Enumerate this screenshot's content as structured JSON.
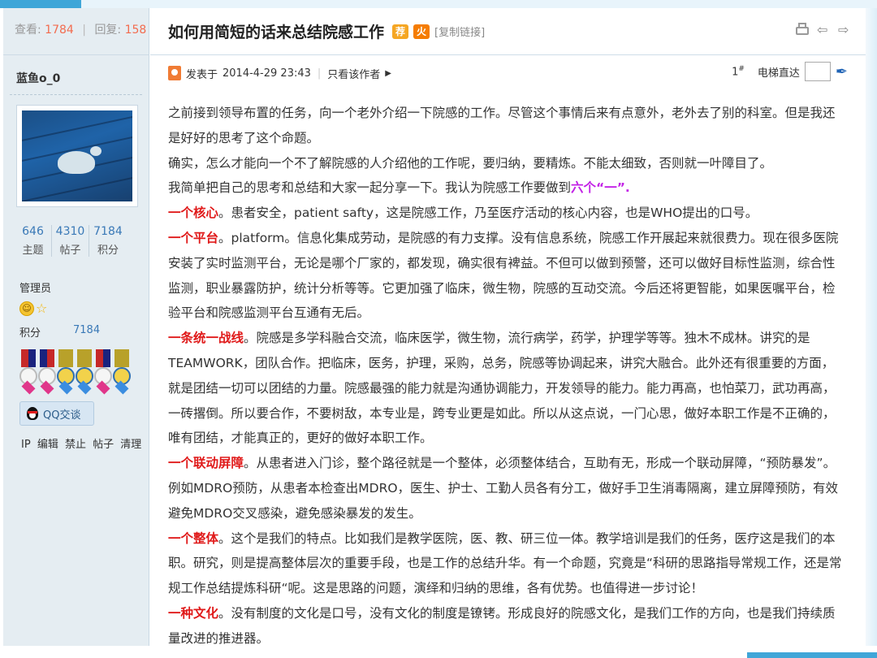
{
  "stats_header": {
    "views_label": "查看:",
    "views": "1784",
    "replies_label": "回复:",
    "replies": "158"
  },
  "thread": {
    "title": "如何用简短的话来总结院感工作",
    "badge1": "荐",
    "badge2": "火",
    "copy_link": "[复制链接]"
  },
  "author": {
    "name": "蓝鱼o_0",
    "stats": [
      {
        "value": "646",
        "label": "主题"
      },
      {
        "value": "4310",
        "label": "帖子"
      },
      {
        "value": "7184",
        "label": "积分"
      }
    ],
    "group": "管理员",
    "points_label": "积分",
    "points_value": "7184",
    "qq_label": "QQ交谈",
    "admin_links": [
      "IP",
      "编辑",
      "禁止",
      "帖子",
      "清理"
    ]
  },
  "post": {
    "posted_label": "发表于",
    "posted_time": "2014-4-29 23:43",
    "only_author": "只看该作者",
    "floor": "1",
    "floor_sup": "#",
    "elevator": "电梯直达"
  },
  "content": {
    "p1": "之前接到领导布置的任务，向一个老外介绍一下院感的工作。尽管这个事情后来有点意外，老外去了别的科室。但是我还是好好的思考了这个命题。",
    "p2": "确实，怎么才能向一个不了解院感的人介绍他的工作呢，要归纳，要精炼。不能太细致，否则就一叶障目了。",
    "p3_a": "我简单把自己的思考和总结和大家一起分享一下。我认为院感工作要做到",
    "p3_b": "六个“一”.",
    "p4_h": "一个核心",
    "p4": "。患者安全，patient safty，这是院感工作，乃至医疗活动的核心内容，也是WHO提出的口号。",
    "p5_h": "一个平台",
    "p5": "。platform。信息化集成劳动，是院感的有力支撑。没有信息系统，院感工作开展起来就很费力。现在很多医院安装了实时监测平台，无论是哪个厂家的，都发现，确实很有裨益。不但可以做到预警，还可以做好目标性监测，综合性监测，职业暴露防护，统计分析等等。它更加强了临床，微生物，院感的互动交流。今后还将更智能，如果医嘱平台，检验平台和院感监测平台互通有无后。",
    "p6_h": "一条统一战线",
    "p6": "。院感是多学科融合交流，临床医学，微生物，流行病学，药学，护理学等等。独木不成林。讲究的是TEAMWORK，团队合作。把临床，医务，护理，采购，总务，院感等协调起来，讲究大融合。此外还有很重要的方面，就是团结一切可以团结的力量。院感最强的能力就是沟通协调能力，开发领导的能力。能力再高，也怕菜刀，武功再高，一砖撂倒。所以要合作，不要树敌，本专业是，跨专业更是如此。所以从这点说，一门心思，做好本职工作是不正确的，唯有团结，才能真正的，更好的做好本职工作。",
    "p7_h": "一个联动屏障",
    "p7": "。从患者进入门诊，整个路径就是一个整体，必须整体结合，互助有无，形成一个联动屏障，“预防暴发”。例如MDRO预防，从患者本检查出MDRO，医生、护士、工勤人员各有分工，做好手卫生消毒隔离，建立屏障预防，有效避免MDRO交叉感染，避免感染暴发的发生。",
    "p8_h": "一个整体",
    "p8": "。这个是我们的特点。比如我们是教学医院，医、教、研三位一体。教学培训是我们的任务，医疗这是我们的本职。研究，则是提高整体层次的重要手段，也是工作的总结升华。有一个命题，究竟是“科研的思路指导常规工作，还是常规工作总结提炼科研“呢。这是思路的问题，演绎和归纳的思维，各有优势。也值得进一步讨论！",
    "p9_h": "一种文化",
    "p9": "。没有制度的文化是口号，没有文化的制度是镣铐。形成良好的院感文化，是我们工作的方向，也是我们持续质量改进的推进器。"
  },
  "colors": {
    "highlight_red": "#e01a1a",
    "highlight_purple": "#c220e6",
    "sidebar_bg": "#e5edf2",
    "link_blue": "#3a79b7",
    "count_orange": "#f26c4f"
  }
}
